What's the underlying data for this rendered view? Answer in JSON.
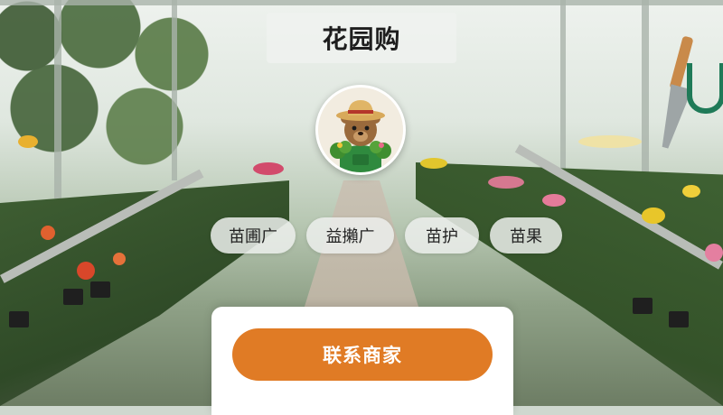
{
  "app": {
    "title": "花园购"
  },
  "categories": [
    {
      "label": "苗圃广"
    },
    {
      "label": "益攋广"
    },
    {
      "label": "苗护"
    },
    {
      "label": "苗果"
    }
  ],
  "actions": {
    "contact_label": "联系商家"
  },
  "avatar": {
    "icon": "bear-gardener-icon"
  },
  "colors": {
    "accent": "#e07b25",
    "chip_bg": "#ecEEec",
    "card_bg": "#ffffff"
  }
}
